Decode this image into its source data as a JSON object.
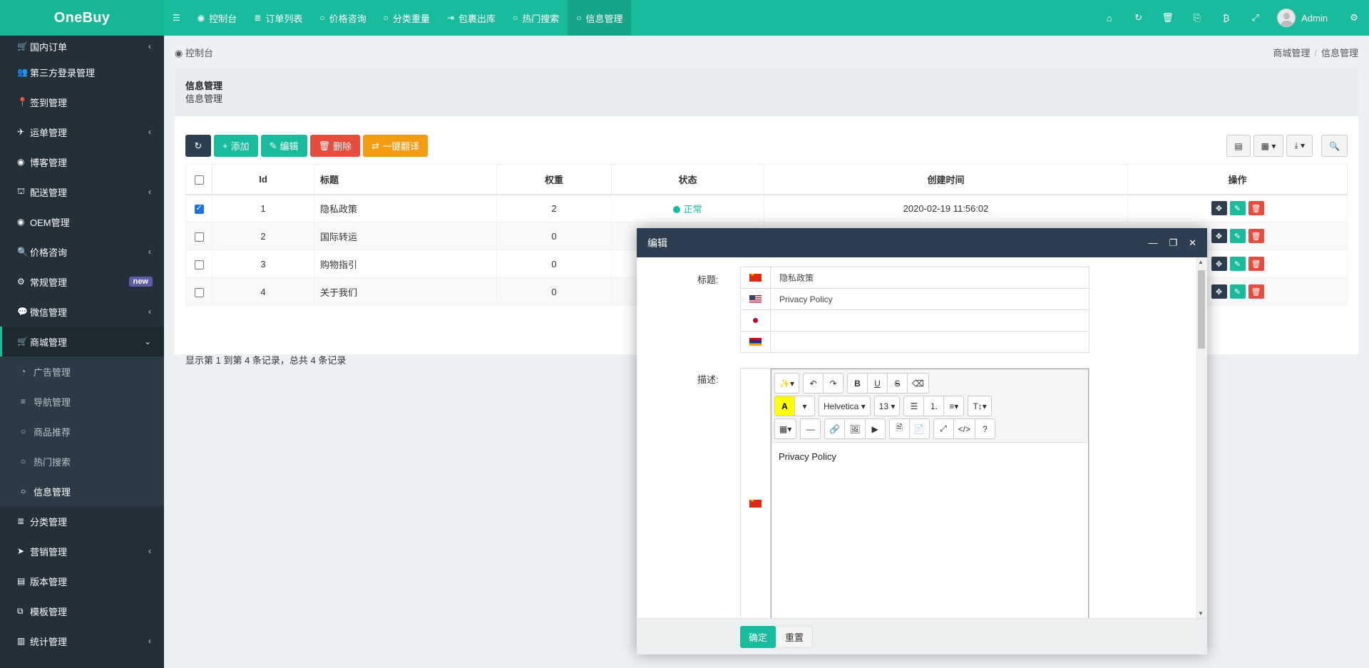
{
  "app": {
    "logo": "OneBuy",
    "admin_name": "Admin"
  },
  "topnav": [
    {
      "icon": "☰",
      "label": ""
    },
    {
      "icon": "◉",
      "label": "控制台"
    },
    {
      "icon": "≣",
      "label": "订单列表"
    },
    {
      "icon": "○",
      "label": "价格咨询"
    },
    {
      "icon": "○",
      "label": "分类重量"
    },
    {
      "icon": "⇥",
      "label": "包裹出库"
    },
    {
      "icon": "○",
      "label": "热门搜索"
    },
    {
      "icon": "○",
      "label": "信息管理"
    }
  ],
  "topnav_right_icons": [
    "⌂",
    "↻",
    "🗑",
    "⎘",
    "₿",
    "⤢"
  ],
  "sidebar": [
    {
      "icon": "🛒",
      "label": "国内订单",
      "chevron": "‹"
    },
    {
      "icon": "👥",
      "label": "第三方登录管理"
    },
    {
      "icon": "📍",
      "label": "签到管理"
    },
    {
      "icon": "✈",
      "label": "运单管理",
      "chevron": "‹"
    },
    {
      "icon": "◉",
      "label": "博客管理"
    },
    {
      "icon": "⛫",
      "label": "配送管理",
      "chevron": "‹"
    },
    {
      "icon": "◉",
      "label": "OEM管理"
    },
    {
      "icon": "🔍",
      "label": "价格咨询",
      "chevron": "‹"
    },
    {
      "icon": "⚙",
      "label": "常规管理",
      "badge": "new"
    },
    {
      "icon": "💬",
      "label": "微信管理",
      "chevron": "‹"
    },
    {
      "icon": "🛒",
      "label": "商城管理",
      "chevron": "⌄"
    }
  ],
  "sidebar_sub": [
    {
      "icon": "◔",
      "label": "广告管理"
    },
    {
      "icon": "≡",
      "label": "导航管理"
    },
    {
      "icon": "○",
      "label": "商品推荐"
    },
    {
      "icon": "○",
      "label": "热门搜索"
    },
    {
      "icon": "○",
      "label": "信息管理"
    }
  ],
  "sidebar_after": [
    {
      "icon": "≣",
      "label": "分类管理"
    },
    {
      "icon": "➤",
      "label": "营销管理",
      "chevron": "‹"
    },
    {
      "icon": "▤",
      "label": "版本管理"
    },
    {
      "icon": "⧉",
      "label": "模板管理"
    },
    {
      "icon": "▥",
      "label": "统计管理",
      "chevron": "‹"
    }
  ],
  "breadcrumb": {
    "home": "控制台",
    "path1": "商城管理",
    "path2": "信息管理"
  },
  "panel": {
    "title": "信息管理",
    "subtitle": "信息管理"
  },
  "toolbar": {
    "add": "添加",
    "edit": "编辑",
    "delete": "删除",
    "translate": "一键翻译"
  },
  "table": {
    "headers": {
      "id": "Id",
      "title": "标题",
      "weight": "权重",
      "status": "状态",
      "created": "创建时间",
      "ops": "操作"
    },
    "rows": [
      {
        "id": "1",
        "title": "隐私政策",
        "weight": "2",
        "status": "正常",
        "created": "2020-02-19 11:56:02",
        "checked": true
      },
      {
        "id": "2",
        "title": "国际转运",
        "weight": "0"
      },
      {
        "id": "3",
        "title": "购物指引",
        "weight": "0"
      },
      {
        "id": "4",
        "title": "关于我们",
        "weight": "0"
      }
    ],
    "summary": "显示第 1 到第 4 条记录，总共 4 条记录"
  },
  "modal": {
    "title": "编辑",
    "label_title": "标题:",
    "label_desc": "描述:",
    "titles": [
      {
        "flag": "cn",
        "value": "隐私政策"
      },
      {
        "flag": "us",
        "value": "Privacy Policy"
      },
      {
        "flag": "jp",
        "value": ""
      },
      {
        "flag": "ar",
        "value": ""
      }
    ],
    "editor": {
      "font": "Helvetica",
      "size": "13",
      "content": "Privacy Policy"
    },
    "ok": "确定",
    "reset": "重置"
  }
}
